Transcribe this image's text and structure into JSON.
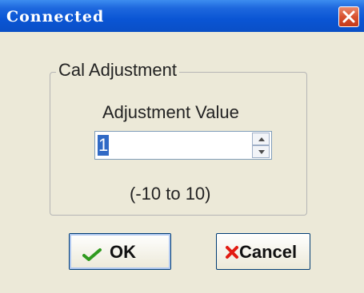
{
  "window": {
    "title": "Connected"
  },
  "group": {
    "legend": "Cal Adjustment"
  },
  "adjustment": {
    "label": "Adjustment Value",
    "value": "1",
    "range_text": "(-10 to 10)"
  },
  "buttons": {
    "ok_label": "OK",
    "cancel_label": "Cancel"
  },
  "colors": {
    "title_bar": "#0a55d4",
    "close_button": "#d85230",
    "selection": "#316ac5",
    "ok_check": "#2f9a1e",
    "cancel_x": "#e21b12"
  },
  "icons": {
    "close": "close-icon",
    "check": "checkmark-icon",
    "cancel": "cross-icon",
    "up": "arrow-up-icon",
    "down": "arrow-down-icon"
  }
}
